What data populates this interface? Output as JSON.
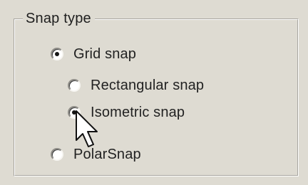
{
  "groupbox": {
    "legend": "Snap type"
  },
  "options": [
    {
      "label": "Grid snap",
      "checked": true
    },
    {
      "label": "Rectangular snap",
      "checked": false
    },
    {
      "label": "Isometric snap",
      "checked": true
    },
    {
      "label": "PolarSnap",
      "checked": false
    }
  ],
  "icons": {
    "cursor": "arrow-cursor-icon"
  },
  "colors": {
    "background": "#dedbd2",
    "text": "#222222",
    "border_dark": "#a7a59f",
    "border_light": "#ffffff"
  }
}
